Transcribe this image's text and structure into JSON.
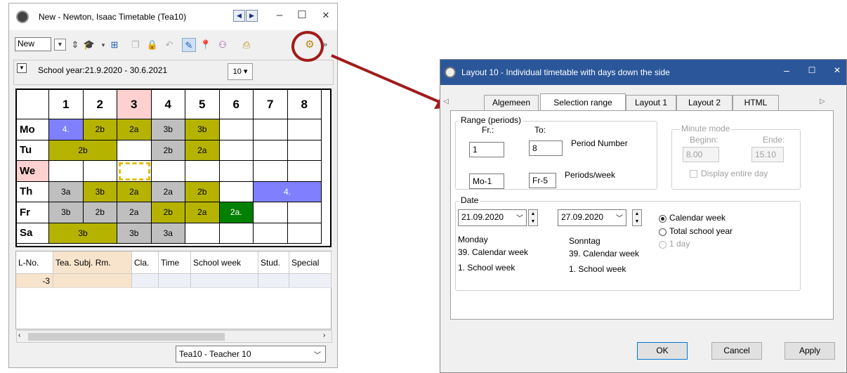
{
  "colors": {
    "purple": "#8080ff",
    "olive": "#b5b300",
    "grey": "#bfbfbf",
    "green": "#008000",
    "pink": "#ffd0d0",
    "lesson_list_row": "#f8e4cc",
    "title_active": "#2b579a",
    "annotation": "#a11b1b"
  },
  "left_window": {
    "title": "New - Newton, Isaac Timetable (Tea10)",
    "caption_min": "–",
    "caption_max": "☐",
    "caption_close": "✕",
    "nav_prev": "◀",
    "nav_next": "▶",
    "view_select": "New",
    "range_text": "School year:21.9.2020 - 30.6.2021",
    "cal_label": "10 ▾",
    "teacher_select": "Tea10 - Teacher 10",
    "grid": {
      "columns": [
        "1",
        "2",
        "3",
        "4",
        "5",
        "6",
        "7",
        "8"
      ],
      "rows": [
        {
          "day": "Mo",
          "cells": [
            {
              "text": "4.",
              "color": "purple",
              "span": 1
            },
            {
              "text": "2b",
              "color": "olive",
              "span": 1
            },
            {
              "text": "2a",
              "color": "olive",
              "span": 1
            },
            {
              "text": "3b",
              "color": "grey",
              "span": 1
            },
            {
              "text": "3b",
              "color": "olive",
              "span": 1
            },
            {
              "text": "",
              "color": "",
              "span": 1
            },
            {
              "text": "",
              "color": "",
              "span": 1
            },
            {
              "text": "",
              "color": "",
              "span": 1
            }
          ]
        },
        {
          "day": "Tu",
          "cells": [
            {
              "text": "2b",
              "color": "olive",
              "span": 2
            },
            {
              "text": "",
              "color": "",
              "span": 1
            },
            {
              "text": "2b",
              "color": "grey",
              "span": 1
            },
            {
              "text": "2a",
              "color": "olive",
              "span": 1
            },
            {
              "text": "",
              "color": "",
              "span": 1
            },
            {
              "text": "",
              "color": "",
              "span": 1
            },
            {
              "text": "",
              "color": "",
              "span": 1
            }
          ]
        },
        {
          "day": "We",
          "cells": [
            {
              "text": "",
              "color": "",
              "span": 1
            },
            {
              "text": "",
              "color": "",
              "span": 1
            },
            {
              "text": "",
              "color": "",
              "span": 1,
              "selected": true
            },
            {
              "text": "",
              "color": "",
              "span": 1
            },
            {
              "text": "",
              "color": "",
              "span": 1
            },
            {
              "text": "",
              "color": "",
              "span": 1
            },
            {
              "text": "",
              "color": "",
              "span": 1
            },
            {
              "text": "",
              "color": "",
              "span": 1
            }
          ]
        },
        {
          "day": "Th",
          "cells": [
            {
              "text": "3a",
              "color": "grey",
              "span": 1
            },
            {
              "text": "3b",
              "color": "olive",
              "span": 1
            },
            {
              "text": "2a",
              "color": "olive",
              "span": 1
            },
            {
              "text": "2a",
              "color": "grey",
              "span": 1
            },
            {
              "text": "2b",
              "color": "olive",
              "span": 1
            },
            {
              "text": "",
              "color": "",
              "span": 1
            },
            {
              "text": "4.",
              "color": "purple",
              "span": 2
            }
          ]
        },
        {
          "day": "Fr",
          "cells": [
            {
              "text": "3b",
              "color": "grey",
              "span": 1
            },
            {
              "text": "2b",
              "color": "grey",
              "span": 1
            },
            {
              "text": "2a",
              "color": "grey",
              "span": 1
            },
            {
              "text": "2b",
              "color": "olive",
              "span": 1
            },
            {
              "text": "2a",
              "color": "olive",
              "span": 1
            },
            {
              "text": "2a.",
              "color": "green",
              "span": 1
            },
            {
              "text": "",
              "color": "",
              "span": 1
            },
            {
              "text": "",
              "color": "",
              "span": 1
            }
          ]
        },
        {
          "day": "Sa",
          "cells": [
            {
              "text": "3b",
              "color": "olive",
              "span": 2
            },
            {
              "text": "3b",
              "color": "grey",
              "span": 1
            },
            {
              "text": "3a",
              "color": "grey",
              "span": 1
            },
            {
              "text": "",
              "color": "",
              "span": 1
            },
            {
              "text": "",
              "color": "",
              "span": 1
            },
            {
              "text": "",
              "color": "",
              "span": 1
            },
            {
              "text": "",
              "color": "",
              "span": 1
            }
          ]
        }
      ]
    },
    "lesson_list": {
      "headers": [
        "L-No.",
        "Tea. Subj. Rm.",
        "Cla.",
        "Time",
        "School week",
        "Stud.",
        "Special"
      ],
      "row": [
        "-3",
        "",
        "",
        "",
        "",
        "",
        ""
      ]
    }
  },
  "dialog": {
    "title": "Layout 10 - Individual timetable with days down the side",
    "caption_min": "–",
    "caption_max": "☐",
    "caption_close": "✕",
    "tab_scroll_left": "◁",
    "tab_scroll_right": "▷",
    "tabs": [
      "Algemeen",
      "Selection range",
      "Layout 1",
      "Layout 2",
      "HTML"
    ],
    "selected_tab": "Selection range",
    "range": {
      "title": "Range (periods)",
      "from_label": "Fr.:",
      "to_label": "To:",
      "from_period": "1",
      "to_period": "8",
      "period_number_label": "Period Number",
      "from_week": "Mo-1",
      "to_week": "Fr-5",
      "periods_week_label": "Periods/week"
    },
    "minute_mode": {
      "title": "Minute mode",
      "begin_label": "Beginn:",
      "end_label": "Ende:",
      "begin": "8.00",
      "end": "15.10",
      "display_entire_day": "Display entire day"
    },
    "date": {
      "title": "Date",
      "from_date": "21.09.2020",
      "to_date": "27.09.2020",
      "from_day": "Monday",
      "from_cal_week": "39. Calendar week",
      "from_school_week": "1. School week",
      "to_day": "Sonntag",
      "to_cal_week": "39. Calendar week",
      "to_school_week": "1. School week",
      "options": [
        "Calendar week",
        "Total school year",
        "1 day"
      ],
      "selected": "Calendar week"
    },
    "buttons": {
      "ok": "OK",
      "cancel": "Cancel",
      "apply": "Apply"
    }
  }
}
